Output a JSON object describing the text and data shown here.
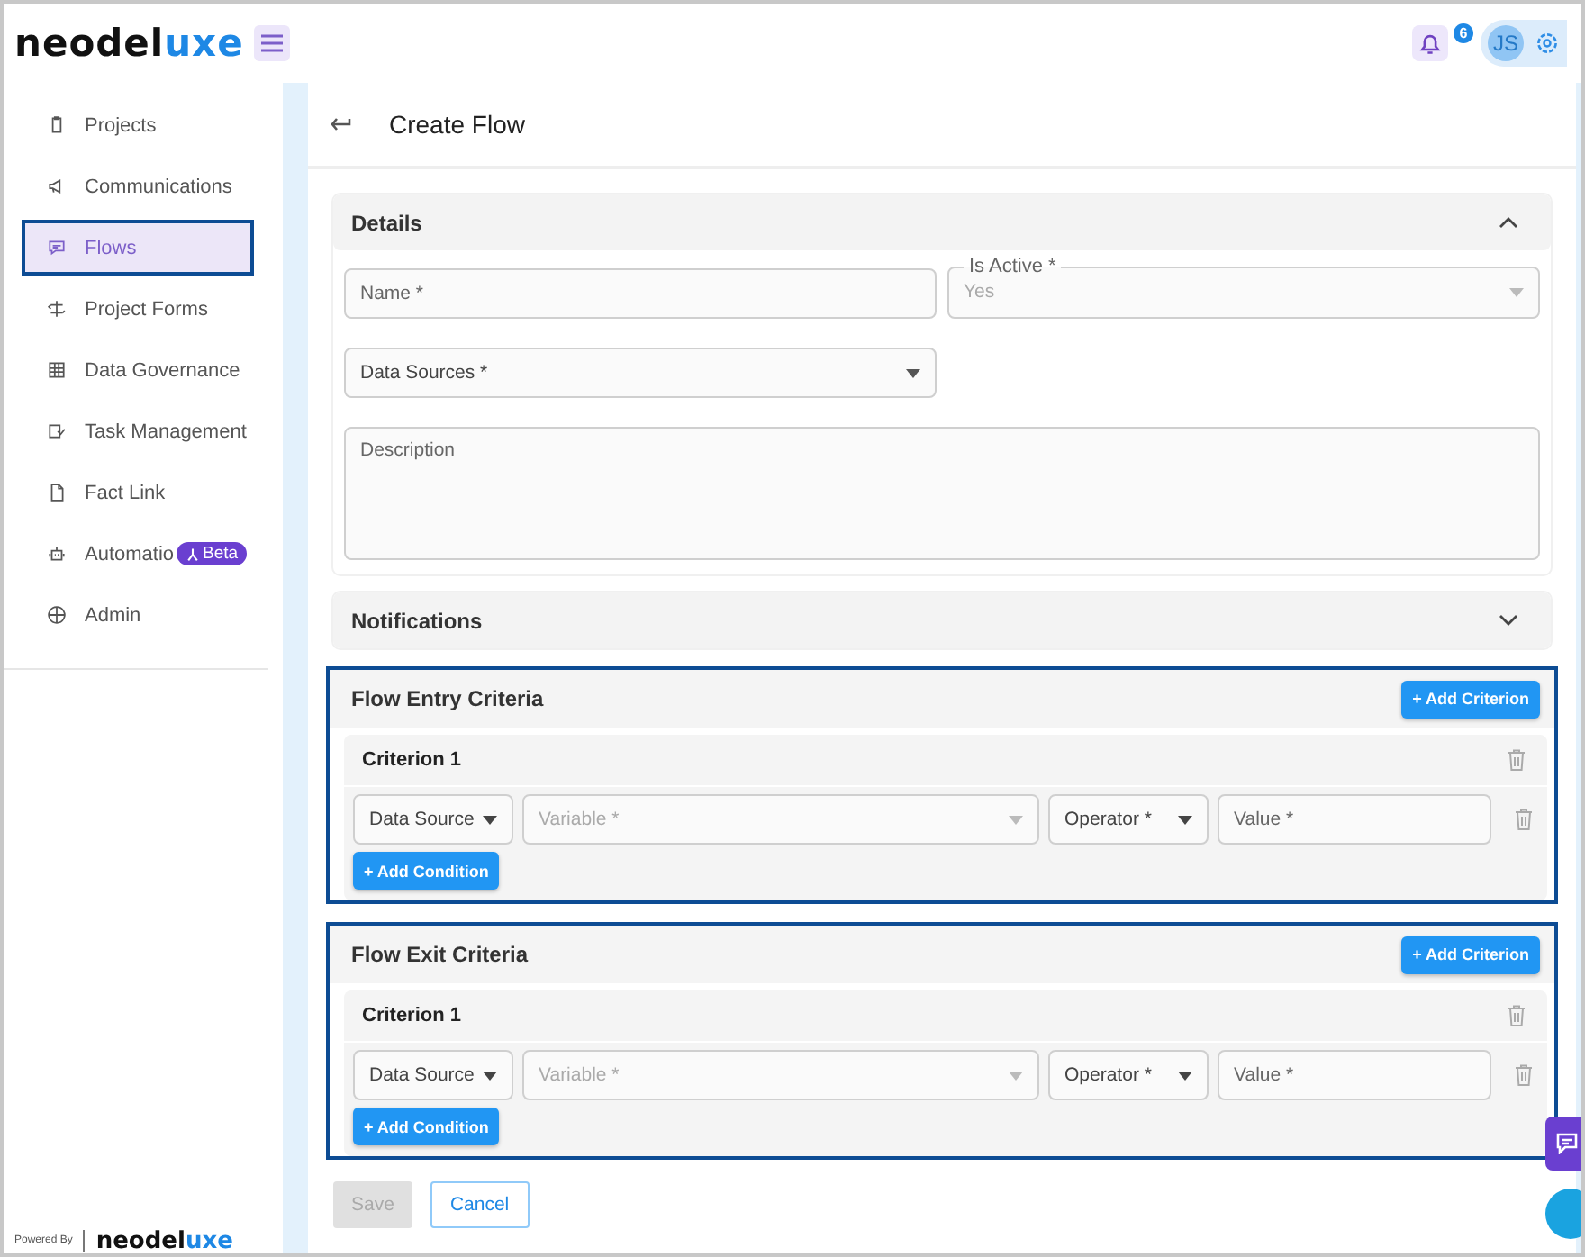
{
  "logo": {
    "parts": [
      {
        "text": "neodel",
        "accent": false
      },
      {
        "text": "uxe",
        "accent": true
      }
    ]
  },
  "topbar": {
    "notification_count": "6",
    "avatar": "JS"
  },
  "sidebar": {
    "items": [
      {
        "label": "Projects",
        "selected": false,
        "highlighted": false
      },
      {
        "label": "Communications",
        "selected": false,
        "highlighted": false
      },
      {
        "label": "Flows",
        "selected": true,
        "highlighted": true
      },
      {
        "label": "Project Forms",
        "selected": false,
        "highlighted": false
      },
      {
        "label": "Data Governance",
        "selected": false,
        "highlighted": false
      },
      {
        "label": "Task Management",
        "selected": false,
        "highlighted": false
      },
      {
        "label": "Fact Link",
        "selected": false,
        "highlighted": false
      },
      {
        "label": "Automatio",
        "selected": false,
        "highlighted": false,
        "badge": "Beta"
      },
      {
        "label": "Admin",
        "selected": false,
        "highlighted": false
      }
    ],
    "footer": {
      "powered_by": "Powered By",
      "brand_parts": [
        {
          "text": "neodel",
          "accent": false
        },
        {
          "text": "uxe",
          "accent": true
        }
      ]
    }
  },
  "page": {
    "title": "Create Flow"
  },
  "details": {
    "title": "Details",
    "expanded": true,
    "fields": [
      {
        "kind": "text",
        "placeholder": "Name *"
      },
      {
        "kind": "select",
        "label": "Is Active *",
        "value": "Yes",
        "disabled": true
      },
      {
        "kind": "select",
        "placeholder": "Data Sources *"
      },
      {
        "kind": "textarea",
        "placeholder": "Description"
      }
    ]
  },
  "notifications": {
    "title": "Notifications",
    "expanded": false
  },
  "criteria_sections": [
    {
      "title": "Flow Entry Criteria",
      "add_label": "+ Add Criterion",
      "highlighted": true,
      "criteria": [
        {
          "title": "Criterion 1",
          "conditions": [
            {
              "fields": [
                {
                  "kind": "select",
                  "value": "Data Source"
                },
                {
                  "kind": "select",
                  "placeholder": "Variable *"
                },
                {
                  "kind": "select",
                  "value": "Operator *"
                },
                {
                  "kind": "text",
                  "placeholder": "Value *"
                }
              ]
            }
          ],
          "add_condition_label": "+ Add Condition"
        }
      ]
    },
    {
      "title": "Flow Exit Criteria",
      "add_label": "+ Add Criterion",
      "highlighted": true,
      "criteria": [
        {
          "title": "Criterion 1",
          "conditions": [
            {
              "fields": [
                {
                  "kind": "select",
                  "value": "Data Source"
                },
                {
                  "kind": "select",
                  "placeholder": "Variable *"
                },
                {
                  "kind": "select",
                  "value": "Operator *"
                },
                {
                  "kind": "text",
                  "placeholder": "Value *"
                }
              ]
            }
          ],
          "add_condition_label": "+ Add Condition"
        }
      ]
    }
  ],
  "actions": [
    {
      "label": "Save",
      "kind": "primary",
      "disabled": true
    },
    {
      "label": "Cancel",
      "kind": "outline",
      "disabled": false
    }
  ]
}
